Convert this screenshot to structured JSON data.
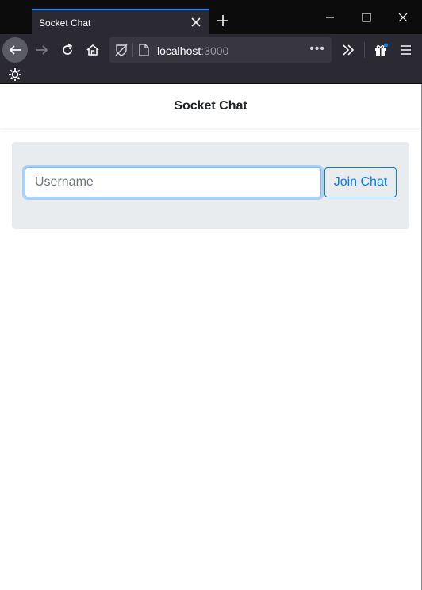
{
  "browser": {
    "tab": {
      "title": "Socket Chat"
    },
    "url": {
      "host": "localhost",
      "port": ":3000"
    },
    "icons": {
      "tab_close": "close-icon",
      "new_tab": "plus-icon",
      "minimize": "minimize-icon",
      "maximize": "maximize-icon",
      "close": "close-icon",
      "back": "arrow-left-icon",
      "forward": "arrow-right-icon",
      "reload": "reload-icon",
      "home": "home-icon",
      "tracking": "tracking-protection-icon",
      "page": "page-icon",
      "more": "ellipsis-icon",
      "overflow": "chevron-double-right-icon",
      "gift": "gift-icon",
      "menu": "hamburger-menu-icon",
      "extension": "gear-icon"
    },
    "more_label": "•••"
  },
  "app": {
    "title": "Socket Chat",
    "username": {
      "placeholder": "Username",
      "value": ""
    },
    "join_label": "Join Chat"
  },
  "colors": {
    "accent": "#007bff",
    "card_bg": "#e9ecef",
    "browser_dark": "#2b2a33",
    "titlebar": "#0c0c0d",
    "tab_highlight": "#0a84ff"
  }
}
